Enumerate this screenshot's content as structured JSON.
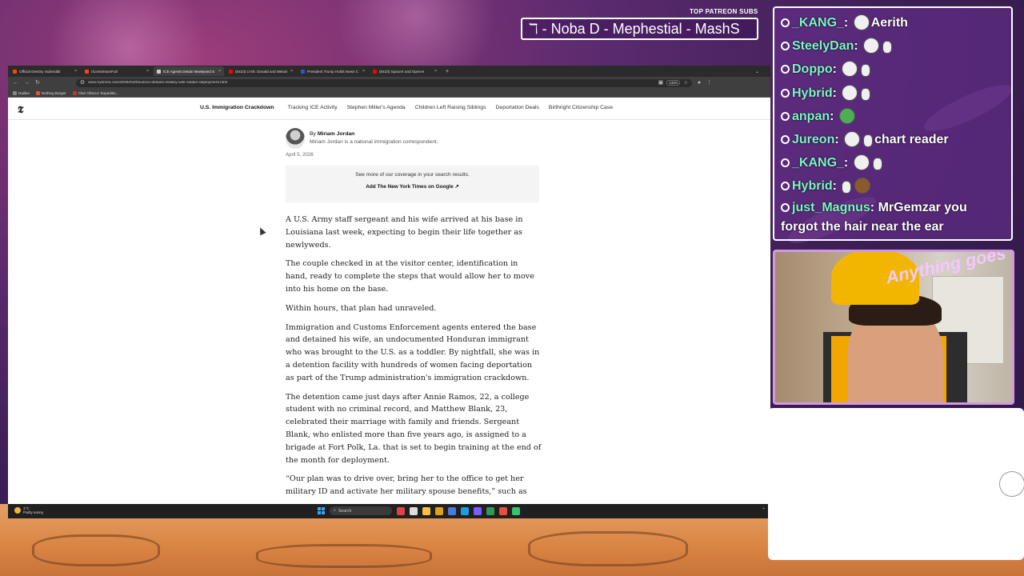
{
  "overlay": {
    "subs_title": "TOP PATREON SUBS",
    "ticker": "ℸ -  Noba D - Mephestial - MashS"
  },
  "browser": {
    "tabs": [
      {
        "label": "Official Destiny Subreddit",
        "color": "#ff4500",
        "active": false
      },
      {
        "label": "r/LivestreamFail",
        "color": "#ff4500",
        "active": false
      },
      {
        "label": "ICE Agents Detain Newlywed S",
        "color": "#cccccc",
        "active": true
      },
      {
        "label": "(8423) LIVE: Donald and Melani",
        "color": "#ff0000",
        "active": false
      },
      {
        "label": "President Trump Holds News C",
        "color": "#3355cc",
        "active": false
      },
      {
        "label": "(8423) SpaceX and OpenAI",
        "color": "#ff0000",
        "active": false
      }
    ],
    "url": "www.nytimes.com/2026/04/05/us/ice-detains-military-wife-soldier-deployment.html",
    "zoom": "133%",
    "bookmarks": [
      {
        "label": "Dailies",
        "color": "#888888"
      },
      {
        "label": "Nothing Burger",
        "color": "#e0553b"
      },
      {
        "label": "Clair Obscur: Expeditio...",
        "color": "#c0392b"
      }
    ]
  },
  "nyt": {
    "logo": "𝕿",
    "nav": [
      "U.S. Immigration Crackdown",
      "Tracking ICE Activity",
      "Stephen Miller's Agenda",
      "Children Left Raising Siblings",
      "Deportation Deals",
      "Birthright Citizenship Case"
    ]
  },
  "article": {
    "by_prefix": "By ",
    "author": "Miriam Jordan",
    "author_desc": "Miriam Jordan is a national immigration correspondent.",
    "date": "April 5, 2026",
    "promo_text": "See more of our coverage in your search results.",
    "promo_button": "Add The New York Times on Google ↗",
    "paragraphs": [
      "A U.S. Army staff sergeant and his wife arrived at his base in Louisiana last week, expecting to begin their life together as newlyweds.",
      "The couple checked in at the visitor center, identification in hand, ready to complete the steps that would allow her to move into his home on the base.",
      "Within hours, that plan had unraveled.",
      "Immigration and Customs Enforcement agents entered the base and detained his wife, an undocumented Honduran immigrant who was brought to the U.S. as a toddler. By nightfall, she was in a detention facility with hundreds of women facing deportation as part of the Trump administration's immigration crackdown.",
      "The detention came just days after Annie Ramos, 22, a college student with no criminal record, and Matthew Blank, 23, celebrated their marriage with family and friends. Sergeant Blank, who enlisted more than five years ago, is assigned to a brigade at Fort Polk, La. that is set to begin training at the end of the month for deployment.",
      "“Our plan was to drive over, bring her to the office to get her military ID and activate her military spouse benefits,” such as"
    ]
  },
  "taskbar": {
    "weather_temp": "1°C",
    "weather_desc": "Partly sunny",
    "search": "Search",
    "apps": [
      "#e04343",
      "#dddddd",
      "#f5c242",
      "#e0a020",
      "#4a7bd8",
      "#1b9de2",
      "#7b5cff",
      "#2f9a54",
      "#e84d3d",
      "#35c46a"
    ]
  },
  "chat": [
    {
      "user": "_KANG_",
      "msg": "Aerith",
      "emotes": [
        "white"
      ]
    },
    {
      "user": "SteelyDan",
      "msg": "",
      "emotes": [
        "white",
        "small"
      ]
    },
    {
      "user": "Doppo",
      "msg": "",
      "emotes": [
        "white",
        "small"
      ]
    },
    {
      "user": "Hybrid",
      "msg": "",
      "emotes": [
        "white",
        "small"
      ]
    },
    {
      "user": "anpan",
      "msg": "",
      "emotes": [
        "green"
      ]
    },
    {
      "user": "Jureon",
      "msg": "chart reader",
      "emotes": [
        "white",
        "small"
      ]
    },
    {
      "user": "_KANG_",
      "msg": "",
      "emotes": [
        "white",
        "small"
      ]
    },
    {
      "user": "Hybrid",
      "msg": "",
      "emotes": [
        "small",
        "brown"
      ]
    },
    {
      "user": "just_Magnus",
      "msg": "MrGemzar you forgot the hair near the ear",
      "emotes": []
    }
  ],
  "cam": {
    "logo": "Anything goes"
  }
}
